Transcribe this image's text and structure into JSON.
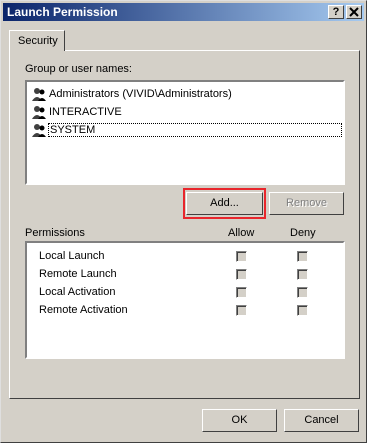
{
  "window": {
    "title": "Launch Permission",
    "help_label": "?",
    "close_label": "X"
  },
  "tabs": [
    {
      "label": "Security"
    }
  ],
  "group_section": {
    "label": "Group or user names:",
    "users": [
      {
        "name": "Administrators (VIVID\\Administrators)"
      },
      {
        "name": "INTERACTIVE"
      },
      {
        "name": "SYSTEM"
      }
    ]
  },
  "buttons": {
    "add": "Add...",
    "remove": "Remove",
    "ok": "OK",
    "cancel": "Cancel"
  },
  "permissions": {
    "header": "Permissions",
    "allow_header": "Allow",
    "deny_header": "Deny",
    "rows": [
      {
        "label": "Local Launch",
        "allow": false,
        "deny": false
      },
      {
        "label": "Remote Launch",
        "allow": false,
        "deny": false
      },
      {
        "label": "Local Activation",
        "allow": false,
        "deny": false
      },
      {
        "label": "Remote Activation",
        "allow": false,
        "deny": false
      }
    ]
  },
  "colors": {
    "highlight": "#e8262c",
    "titlebar": "#0a246a"
  }
}
